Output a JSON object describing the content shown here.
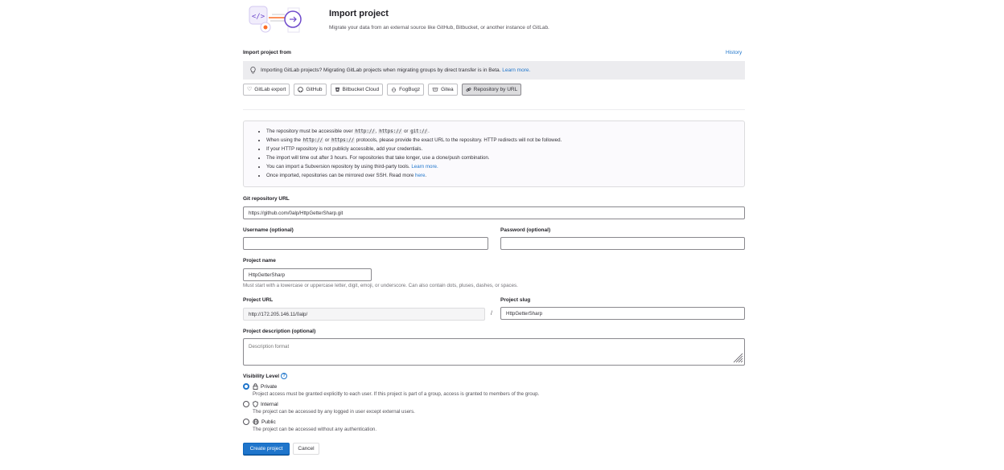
{
  "header": {
    "title": "Import project",
    "subtitle": "Migrate your data from an external source like GitHub, Bitbucket, or another instance of GitLab."
  },
  "import_from": {
    "label": "Import project from",
    "history_link": "History"
  },
  "beta_alert": {
    "text": "Importing GitLab projects? Migrating GitLab projects when migrating groups by direct transfer is in Beta.",
    "link": "Learn more."
  },
  "sources": [
    {
      "label": "GitLab export",
      "icon": "heart-icon"
    },
    {
      "label": "GitHub",
      "icon": "github-icon"
    },
    {
      "label": "Bitbucket Cloud",
      "icon": "bitbucket-icon"
    },
    {
      "label": "FogBugz",
      "icon": "bug-icon"
    },
    {
      "label": "Gitea",
      "icon": "gitea-icon"
    },
    {
      "label": "Repository by URL",
      "icon": "link-icon"
    }
  ],
  "info": {
    "item1_a": "The repository must be accessible over",
    "item1_code1": "http://",
    "item1_sep1": ",",
    "item1_code2": "https://",
    "item1_sep2": "or",
    "item1_code3": "git://",
    "item1_end": ".",
    "item2_a": "When using the",
    "item2_code1": "http://",
    "item2_sep": "or",
    "item2_code2": "https://",
    "item2_b": "protocols, please provide the exact URL to the repository. HTTP redirects will not be followed.",
    "item3": "If your HTTP repository is not publicly accessible, add your credentials.",
    "item4": "The import will time out after 3 hours. For repositories that take longer, use a clone/push combination.",
    "item5_a": "You can import a Subversion repository by using third-party tools.",
    "item5_link": "Learn more.",
    "item6_a": "Once imported, repositories can be mirrored over SSH. Read more",
    "item6_link": "here",
    "item6_end": "."
  },
  "form": {
    "git_url_label": "Git repository URL",
    "git_url_value": "https://github.com/0alp/HttpGetterSharp.git",
    "username_label": "Username (optional)",
    "username_value": "",
    "password_label": "Password (optional)",
    "password_value": "",
    "project_name_label": "Project name",
    "project_name_value": "HttpGetterSharp",
    "project_name_help": "Must start with a lowercase or uppercase letter, digit, emoji, or underscore. Can also contain dots, pluses, dashes, or spaces.",
    "project_url_label": "Project URL",
    "project_url_value": "http://172.205.146.11/0alp/",
    "slash": "/",
    "project_slug_label": "Project slug",
    "project_slug_value": "HttpGetterSharp",
    "description_label": "Project description (optional)",
    "description_placeholder": "Description format"
  },
  "visibility": {
    "label": "Visibility Level",
    "help_icon": "?",
    "options": [
      {
        "label": "Private",
        "icon": "lock-icon",
        "desc": "Project access must be granted explicitly to each user. If this project is part of a group, access is granted to members of the group.",
        "checked": true
      },
      {
        "label": "Internal",
        "icon": "shield-icon",
        "desc": "The project can be accessed by any logged in user except external users.",
        "checked": false
      },
      {
        "label": "Public",
        "icon": "globe-icon",
        "desc": "The project can be accessed without any authentication.",
        "checked": false
      }
    ]
  },
  "actions": {
    "create": "Create project",
    "cancel": "Cancel"
  },
  "colors": {
    "primary": "#1f75cb",
    "illustration_purple": "#6e49cb",
    "illustration_orange": "#fc6d26"
  }
}
